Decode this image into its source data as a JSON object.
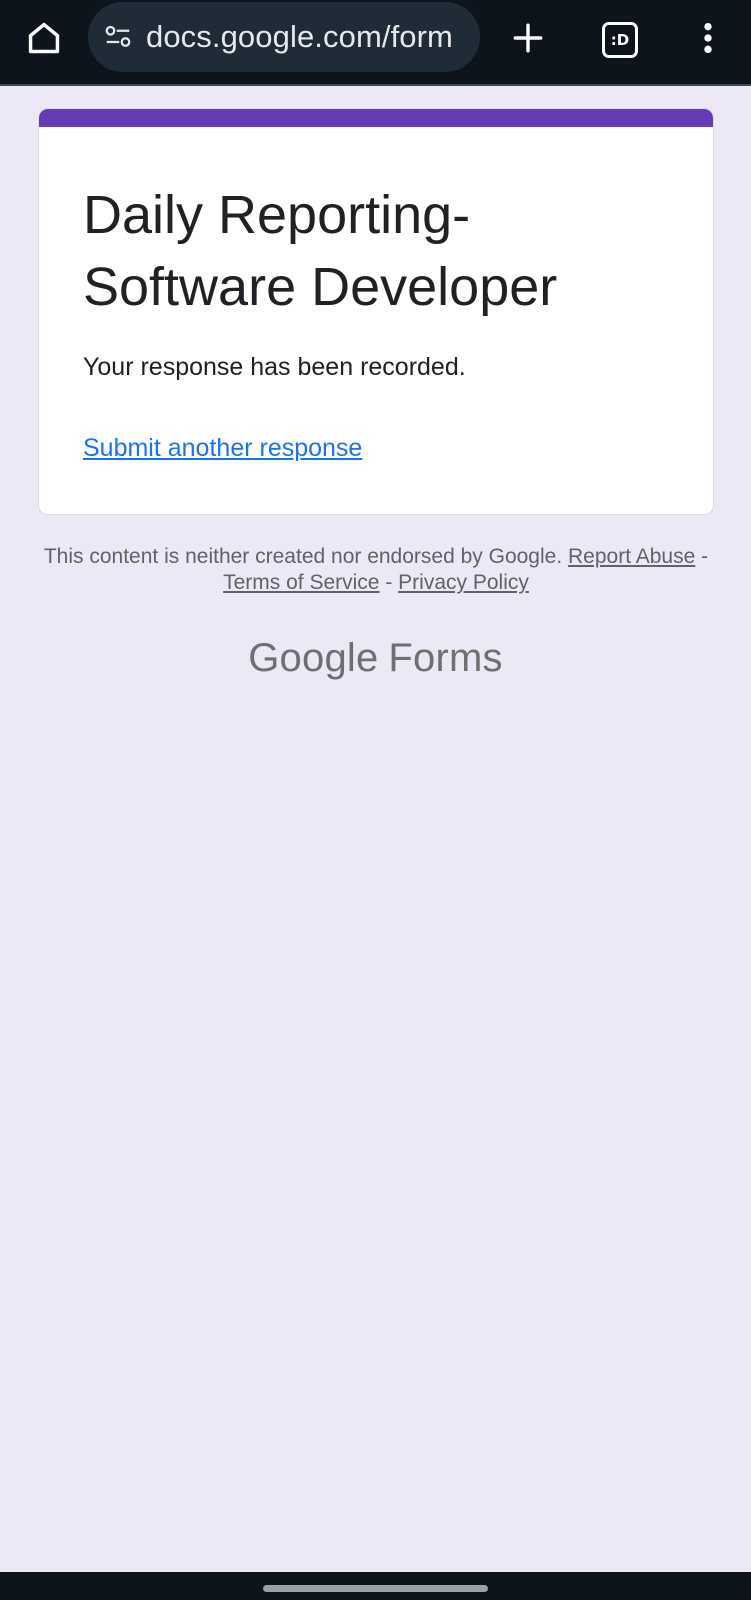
{
  "browser": {
    "url": "docs.google.com/form",
    "tab_count": ":D",
    "icons": {
      "home": "home-icon",
      "site_settings": "tune-icon",
      "new_tab": "plus-icon",
      "tabs": "tab-switcher-icon",
      "menu": "more-vert-icon"
    }
  },
  "form": {
    "title": "Daily Reporting- Software Developer",
    "confirmation": "Your response has been recorded.",
    "submit_another_label": "Submit another response",
    "accent_color": "#673ab7"
  },
  "footer": {
    "disclaimer": "This content is neither created nor endorsed by Google.",
    "report_abuse": "Report Abuse",
    "separator": "-",
    "terms": "Terms of Service",
    "privacy": "Privacy Policy",
    "brand_google": "Google",
    "brand_forms": "Forms"
  },
  "colors": {
    "page_background": "#ede8f6",
    "link": "#1a73e8"
  }
}
